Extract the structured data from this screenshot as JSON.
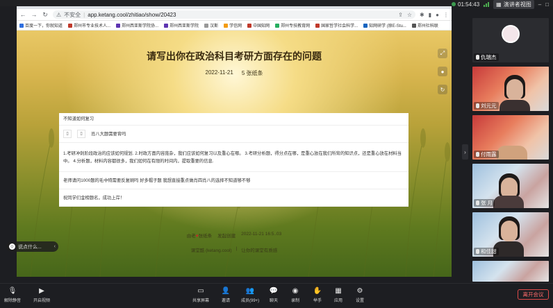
{
  "meeting": {
    "clock": "01:54:43",
    "view_mode": "演讲者视图",
    "leave_label": "离开会议"
  },
  "browser": {
    "insecure_label": "不安全",
    "url": "app.ketang.cool/zhitiao/show/20423",
    "bookmarks": [
      {
        "label": "百度一下，你就知道",
        "color": "#2f6fe0"
      },
      {
        "label": "郑州市专业技术人...",
        "color": "#c0392b"
      },
      {
        "label": "郑州西亚斯学院协...",
        "color": "#5e35b1"
      },
      {
        "label": "郑州西亚斯学院",
        "color": "#5e35b1"
      },
      {
        "label": "汉斯",
        "color": "#999999"
      },
      {
        "label": "学信网",
        "color": "#f39c12"
      },
      {
        "label": "中国知网",
        "color": "#c0392b"
      },
      {
        "label": "郑州专技教育网",
        "color": "#27ae60"
      },
      {
        "label": "国家哲学社会科学...",
        "color": "#c0392b"
      },
      {
        "label": "知网研学 (原E-Stu...",
        "color": "#1565c0"
      },
      {
        "label": "郑州社科联",
        "color": "#555555"
      }
    ]
  },
  "page": {
    "title": "请写出你在政治科目考研方面存在的问题",
    "date": "2022-11-21",
    "count": "5 张纸条",
    "cards": [
      {
        "text": "不知道如何复习"
      },
      {
        "text": "肖八大题需要背吗"
      },
      {
        "text": "1.考研冲刺阶段政治的应该如何规划. 2.时政方面内容庞杂，我们应该如何复习以及重心在哪。 3.考研分析题，得分点在哪，是重心放在我们所背的知识点，还是重心放在材料当中。 4.分析题，材料内容都很多，我们如何在有限的时间内，提取重要的信息."
      },
      {
        "text": "老师请问1000题的毛中特需要反复刷吗 好多帽子题 我想直接重点做肖四肖八的选择不知道够不够"
      },
      {
        "text": "祝同学们金榜题名，成功上岸！"
      }
    ],
    "footer_created": "由老",
    "footer_author": "张纸条",
    "footer_created_suffix": "发起创建",
    "footer_time": "2022-11-21 16:5..03",
    "footer_brand": "课堂酷 (ketang.cool)",
    "footer_brand_suffix": "让你的课堂有质感",
    "chat_placeholder": "说点什么..."
  },
  "participants": [
    {
      "name": "仇瑞杰",
      "type": "avatar"
    },
    {
      "name": "刘元元",
      "type": "camera"
    },
    {
      "name": "付雨露",
      "type": "camera"
    },
    {
      "name": "张 月",
      "type": "camera"
    },
    {
      "name": "和佳甜",
      "type": "camera"
    }
  ],
  "toolbar": {
    "mute": "解除静音",
    "video": "开启视频",
    "share": "共享屏幕",
    "invite": "邀请",
    "members": "成员(99+)",
    "chat": "聊天",
    "record": "录制",
    "raise": "举手",
    "apps": "应用",
    "settings": "设置"
  }
}
